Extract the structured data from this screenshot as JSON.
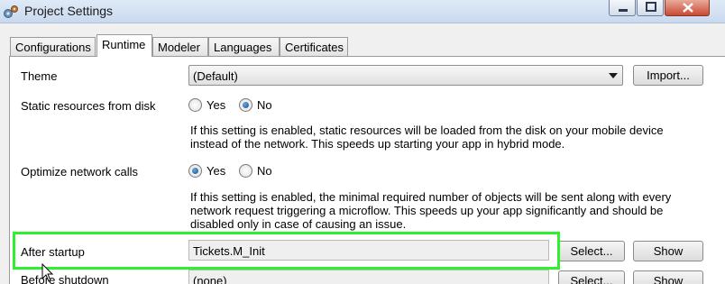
{
  "window": {
    "title": "Project Settings"
  },
  "tabs": [
    {
      "label": "Configurations"
    },
    {
      "label": "Runtime"
    },
    {
      "label": "Modeler"
    },
    {
      "label": "Languages"
    },
    {
      "label": "Certificates"
    }
  ],
  "settings": {
    "theme": {
      "label": "Theme",
      "value": "(Default)",
      "button": "Import..."
    },
    "static_resources": {
      "label": "Static resources from disk",
      "option_yes": "Yes",
      "option_no": "No",
      "selected": "No",
      "help": "If this setting is enabled, static resources will be loaded from the disk on your mobile device instead of the network. This speeds up starting your app in hybrid mode."
    },
    "optimize_network": {
      "label": "Optimize network calls",
      "option_yes": "Yes",
      "option_no": "No",
      "selected": "Yes",
      "help": "If this setting is enabled, the minimal required number of objects will be sent along with every network request triggering a microflow. This speeds up your app significantly and should be disabled only in case of causing an issue."
    },
    "after_startup": {
      "label": "After startup",
      "value": "Tickets.M_Init",
      "select_button": "Select...",
      "show_button": "Show"
    },
    "before_shutdown": {
      "label": "Before shutdown",
      "value": "(none)",
      "select_button": "Select...",
      "show_button": "Show"
    }
  },
  "colors": {
    "highlight": "#2ff02f",
    "radio_selected": "#14508d"
  }
}
